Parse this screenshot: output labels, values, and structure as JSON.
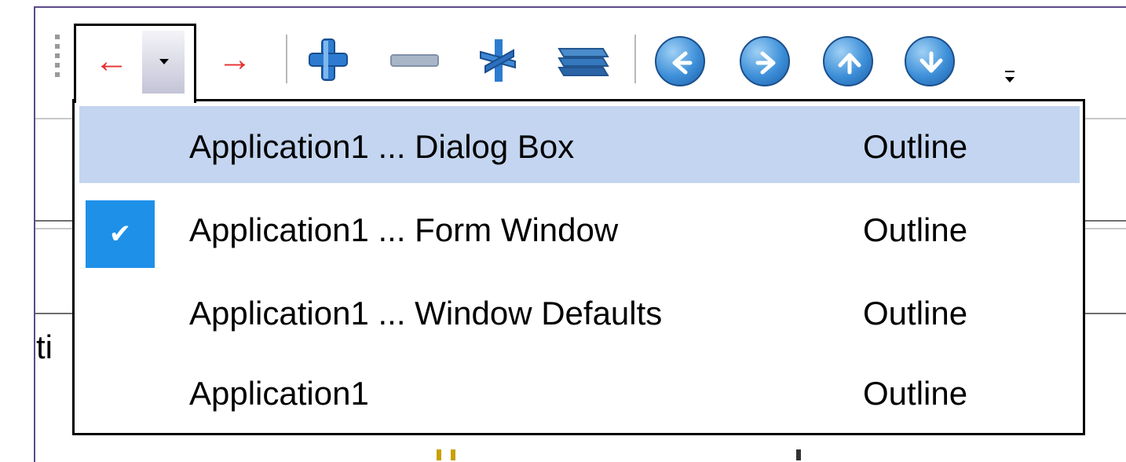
{
  "toolbar": {
    "back_glyph": "←",
    "forward_glyph": "→",
    "icons": [
      "grip-icon",
      "back-arrow-icon",
      "dropdown-arrow-icon",
      "forward-arrow-icon",
      "add-icon",
      "remove-icon",
      "pin-icon",
      "layers-icon",
      "left-circle-icon",
      "right-circle-icon",
      "up-circle-icon",
      "down-circle-icon",
      "overflow-chevron-icon"
    ]
  },
  "menu": {
    "items": [
      {
        "label": "Application1 ... Dialog Box",
        "shortcut": "Outline",
        "checked": false,
        "highlighted": true
      },
      {
        "label": "Application1 ... Form Window",
        "shortcut": "Outline",
        "checked": true,
        "highlighted": false
      },
      {
        "label": "Application1 ... Window Defaults",
        "shortcut": "Outline",
        "checked": false,
        "highlighted": false
      },
      {
        "label": "Application1",
        "shortcut": "Outline",
        "checked": false,
        "highlighted": false
      }
    ],
    "check_glyph": "✔"
  },
  "background": {
    "partial_label": "ti"
  },
  "colors": {
    "highlight": "#c3d5f0",
    "check_bg": "#1e90e8",
    "arrow_red": "#e53030",
    "icon_blue": "#2d7bd0"
  }
}
